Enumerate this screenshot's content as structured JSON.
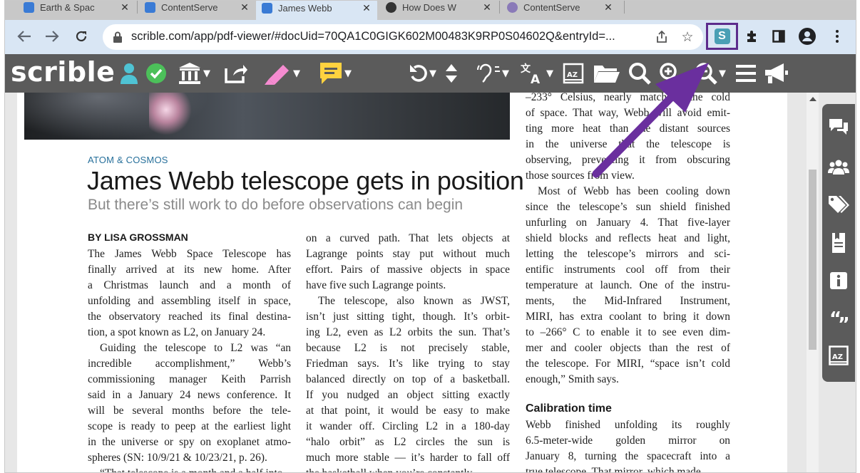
{
  "tabs": [
    {
      "title": "Earth & Spac",
      "active": false
    },
    {
      "title": "ContentServe",
      "active": false
    },
    {
      "title": "James Webb",
      "active": true
    },
    {
      "title": "How Does W",
      "active": false
    },
    {
      "title": "ContentServe",
      "active": false
    }
  ],
  "address_bar": {
    "url": "scrible.com/app/pdf-viewer/#docUid=70QA1C0GIGK602M00483K9RP0S04602Q&entryId=..."
  },
  "extensions": {
    "scrible_label": "S"
  },
  "scrible_toolbar": {
    "logo": "scrible"
  },
  "article": {
    "kicker": "ATOM & COSMOS",
    "headline": "James Webb telescope gets in position",
    "deck": "But there’s still work to do before observations can begin",
    "byline": "BY LISA GROSSMAN",
    "col1": [
      "The James Webb Space Telescope has",
      "finally arrived at its new home. After",
      "a Christmas launch and a month of",
      "unfolding and assembling itself in space,",
      "the observatory reached its final destina-",
      "tion, a spot known as L2, on January 24.",
      "Guiding the telescope to L2 was “an",
      "incredible accomplishment,” Webb’s",
      "commissioning manager Keith Parrish",
      "said in a January 24 news conference. It",
      "will be several months before the tele-",
      "scope is ready to peep at the earliest light",
      "in the universe or spy on exoplanet atmo-",
      "spheres (SN: 10/9/21 & 10/23/21, p. 26).",
      "“That telescope is a month and a half into"
    ],
    "col2": [
      "on a curved path. That lets objects at",
      "Lagrange points stay put without much",
      "effort. Pairs of massive objects in space",
      "have five such Lagrange points.",
      "The telescope, also known as JWST,",
      "isn’t just sitting tight, though. It’s orbit-",
      "ing L2, even as L2 orbits the sun. That’s",
      "because L2 is not precisely stable,",
      "Friedman says. It’s like trying to stay",
      "balanced directly on top of a basketball.",
      "If you nudged an object sitting exactly",
      "at that point, it would be easy to make",
      "it wander off. Circling L2 in a 180-day",
      "“halo orbit” as L2 circles the sun is",
      "much more stable — it’s harder to fall off",
      "the basketball when you’re constantly"
    ],
    "col3a": [
      "–233° Celsius, nearly matching the cold",
      "of space. That way, Webb will avoid emit-",
      "ting more heat than the distant sources",
      "in the universe that the telescope is",
      "observing, preventing it from obscuring",
      "those sources from view.",
      "Most of Webb has been cooling down",
      "since the telescope’s sun shield finished",
      "unfurling on January 4. That five-layer",
      "shield blocks and reflects heat and light,",
      "letting the telescope’s mirrors and sci-",
      "entific instruments cool off from their",
      "temperature at launch. One of the instru-",
      "ments, the Mid-Infrared Instrument,",
      "MIRI, has extra coolant to bring it down",
      "to –266° C to enable it to see even dim-",
      "mer and cooler objects than the rest of",
      "the telescope. For MIRI, “space isn’t cold",
      "enough,” Smith says."
    ],
    "subhead": "Calibration time",
    "col3b": [
      "Webb finished unfolding its roughly",
      "6.5-meter-wide golden mirror on",
      "January 8, turning the spacecraft into a",
      "true telescope. That mirror, which made"
    ]
  },
  "colors": {
    "tab_strip": "#c8c8c8",
    "address_bar": "#d9e6f4",
    "scrible_toolbar": "#5b5b5b",
    "kicker": "#27709b",
    "annotation_arrow": "#6a2f9e",
    "highlight_box": "#5d2c8c"
  },
  "icons": {
    "toolbar": [
      "user-icon",
      "check-icon",
      "library-icon",
      "share-icon",
      "highlighter-icon",
      "sticky-note-icon",
      "undo-icon",
      "up-down-icon",
      "read-aloud-icon",
      "translate-icon",
      "dictionary-icon",
      "folder-icon",
      "search-icon",
      "zoom-in-icon",
      "zoom-out-icon",
      "menu-icon",
      "megaphone-icon"
    ],
    "side_panel": [
      "comments-icon",
      "group-icon",
      "tags-icon",
      "bookmark-icon",
      "info-icon",
      "quote-icon",
      "dictionary-icon"
    ]
  }
}
